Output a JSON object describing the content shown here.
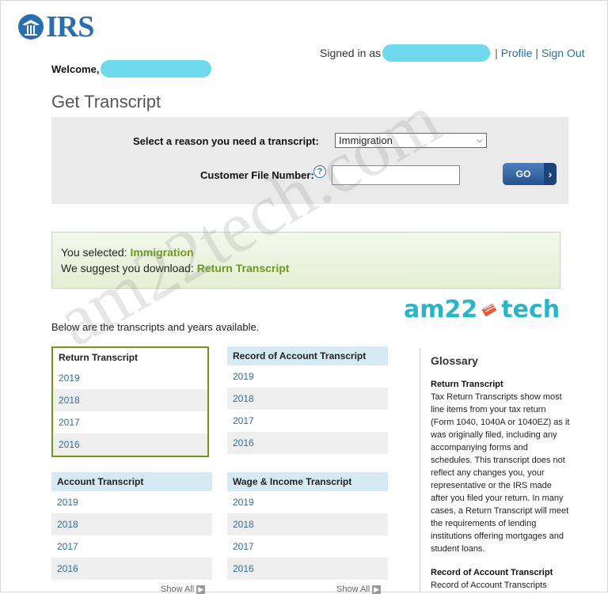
{
  "header": {
    "logo_text": "IRS",
    "signed_in_label": "Signed in as",
    "profile_link": "Profile",
    "sign_out_link": "Sign Out",
    "separator": "|",
    "welcome_label": "Welcome,"
  },
  "page": {
    "title": "Get Transcript"
  },
  "form": {
    "reason_label": "Select a reason you need a transcript:",
    "reason_value": "Immigration",
    "cfn_label": "Customer File Number:",
    "help_glyph": "?",
    "cfn_value": "",
    "go_label": "GO",
    "go_arrow": "›"
  },
  "suggestion": {
    "selected_prefix": "You selected:",
    "selected_value": "Immigration",
    "suggest_prefix": "We suggest you download:",
    "suggest_value": "Return Transcript"
  },
  "watermark": "am22tech.com",
  "brand_logo": {
    "left": "am22",
    "right": "tech"
  },
  "transcripts_intro": "Below are the transcripts and years available.",
  "transcripts": [
    {
      "title": "Return Transcript",
      "years": [
        "2019",
        "2018",
        "2017",
        "2016"
      ],
      "selected": true
    },
    {
      "title": "Record of Account Transcript",
      "years": [
        "2019",
        "2018",
        "2017",
        "2016"
      ],
      "selected": false
    },
    {
      "title": "Account Transcript",
      "years": [
        "2019",
        "2018",
        "2017",
        "2016"
      ],
      "selected": false
    },
    {
      "title": "Wage & Income Transcript",
      "years": [
        "2019",
        "2018",
        "2017",
        "2016"
      ],
      "selected": false
    }
  ],
  "show_all_label": "Show All",
  "glossary": {
    "title": "Glossary",
    "terms": [
      {
        "term": "Return Transcript",
        "definition": "Tax Return Transcripts show most line items from your tax return (Form 1040, 1040A or 1040EZ) as it was originally filed, including any accompanying forms and schedules. This transcript does not reflect any changes you, your representative or the IRS made after you filed your return. In many cases, a Return Transcript will meet the requirements of lending institutions offering mortgages and student loans."
      },
      {
        "term": "Record of Account Transcript",
        "definition": "Record of Account Transcripts"
      }
    ]
  },
  "colors": {
    "irs_blue": "#2a6db1",
    "redaction": "#6fd9ee",
    "highlight_green": "#6c9a18",
    "brand_teal": "#27b6c9"
  }
}
